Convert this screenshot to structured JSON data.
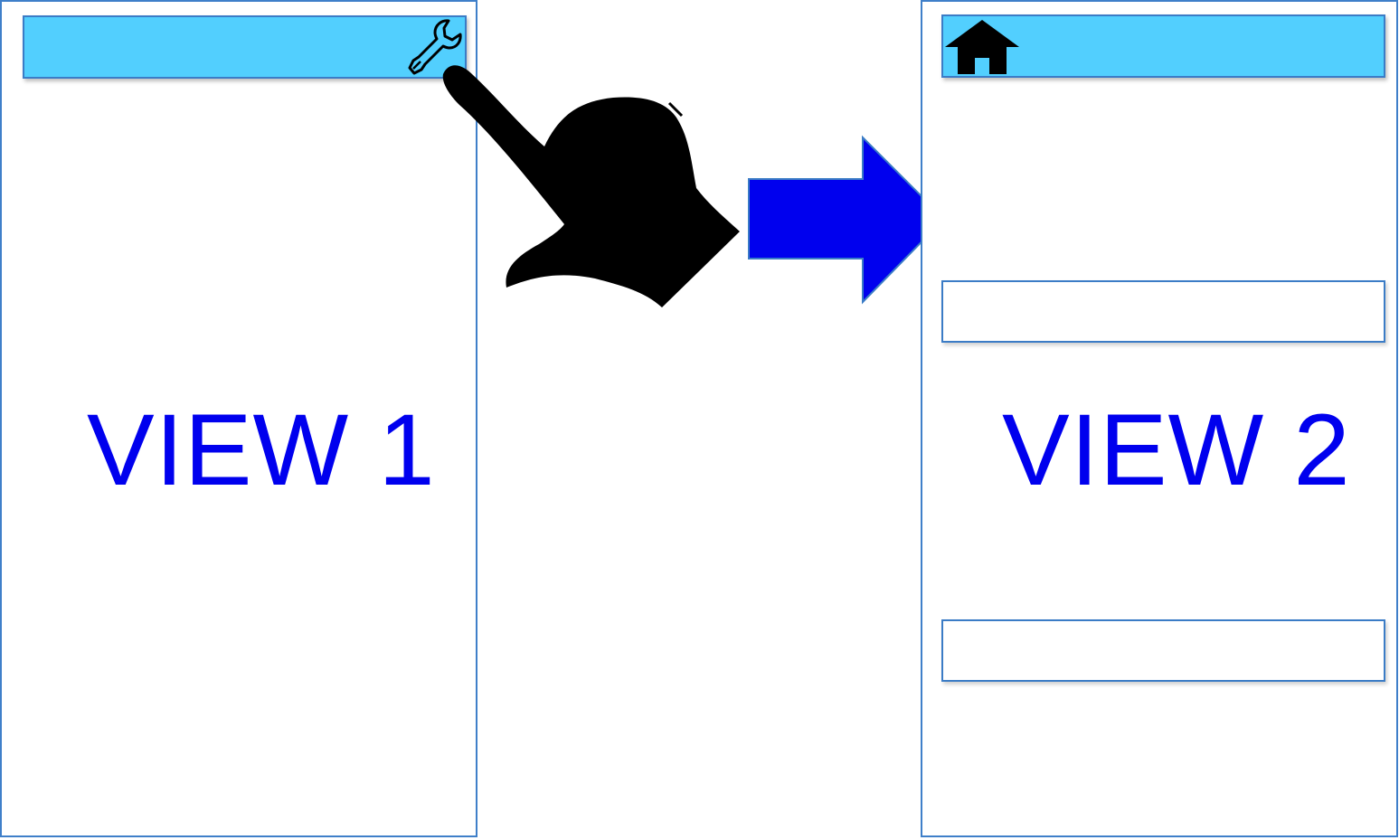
{
  "view1": {
    "label": "VIEW 1",
    "toolbar": {
      "color": "#52cffe",
      "icon": "wrench-icon"
    }
  },
  "view2": {
    "label": "VIEW 2",
    "toolbar": {
      "color": "#52cffe",
      "icon": "home-icon"
    },
    "fields": [
      "",
      ""
    ]
  },
  "transition": {
    "gesture": "pointing-hand-icon",
    "arrow": "right-arrow-icon",
    "arrow_color": "#0000ee"
  }
}
